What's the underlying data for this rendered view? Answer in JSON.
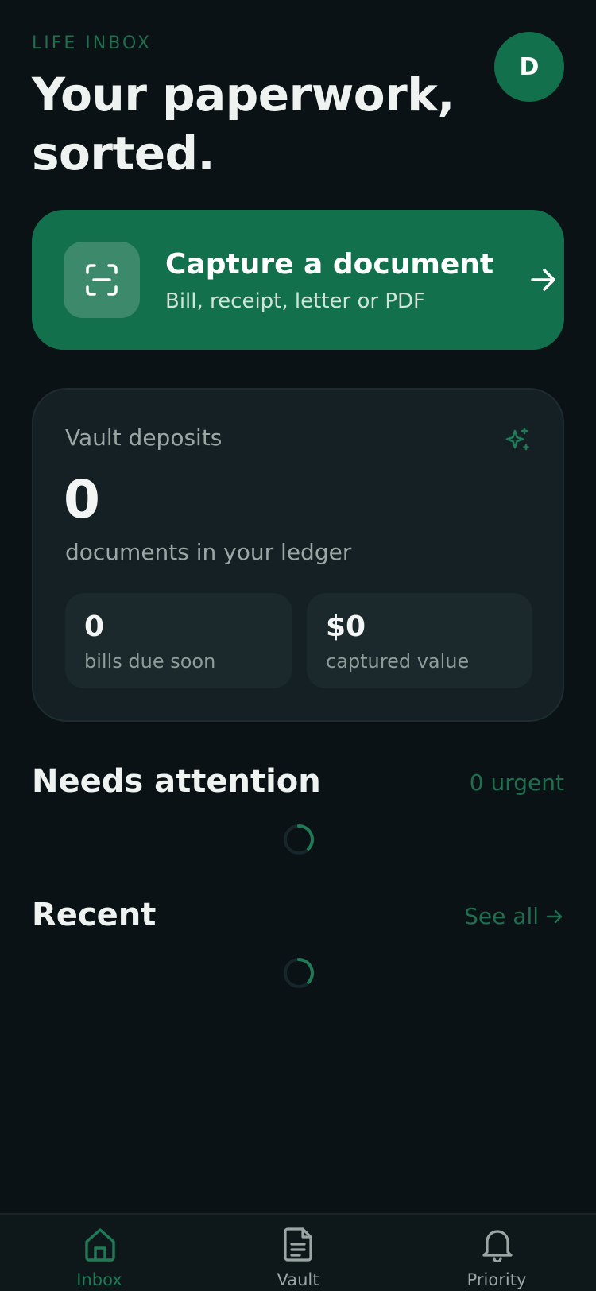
{
  "header": {
    "eyebrow": "LIFE INBOX",
    "title": "Your paperwork, sorted.",
    "avatar_initial": "D"
  },
  "capture_card": {
    "title": "Capture a document",
    "subtitle": "Bill, receipt, letter or PDF",
    "icon": "scan-icon",
    "arrow_icon": "arrow-right-icon"
  },
  "vault_card": {
    "label": "Vault deposits",
    "count": "0",
    "caption": "documents in your ledger",
    "icon": "sparkle-icon",
    "stats": [
      {
        "value": "0",
        "label": "bills due soon"
      },
      {
        "value": "$0",
        "label": "captured value"
      }
    ]
  },
  "needs_attention": {
    "title": "Needs attention",
    "badge": "0 urgent"
  },
  "recent": {
    "title": "Recent",
    "link": "See all"
  },
  "nav": {
    "items": [
      {
        "label": "Inbox",
        "icon": "home-icon",
        "active": true
      },
      {
        "label": "Vault",
        "icon": "document-icon",
        "active": false
      },
      {
        "label": "Priority",
        "icon": "bell-icon",
        "active": false
      }
    ]
  },
  "colors": {
    "background": "#0a1215",
    "accent": "#13704c",
    "accent_text": "#1f6e4e",
    "card": "#142023",
    "muted": "#9aa7a4"
  }
}
